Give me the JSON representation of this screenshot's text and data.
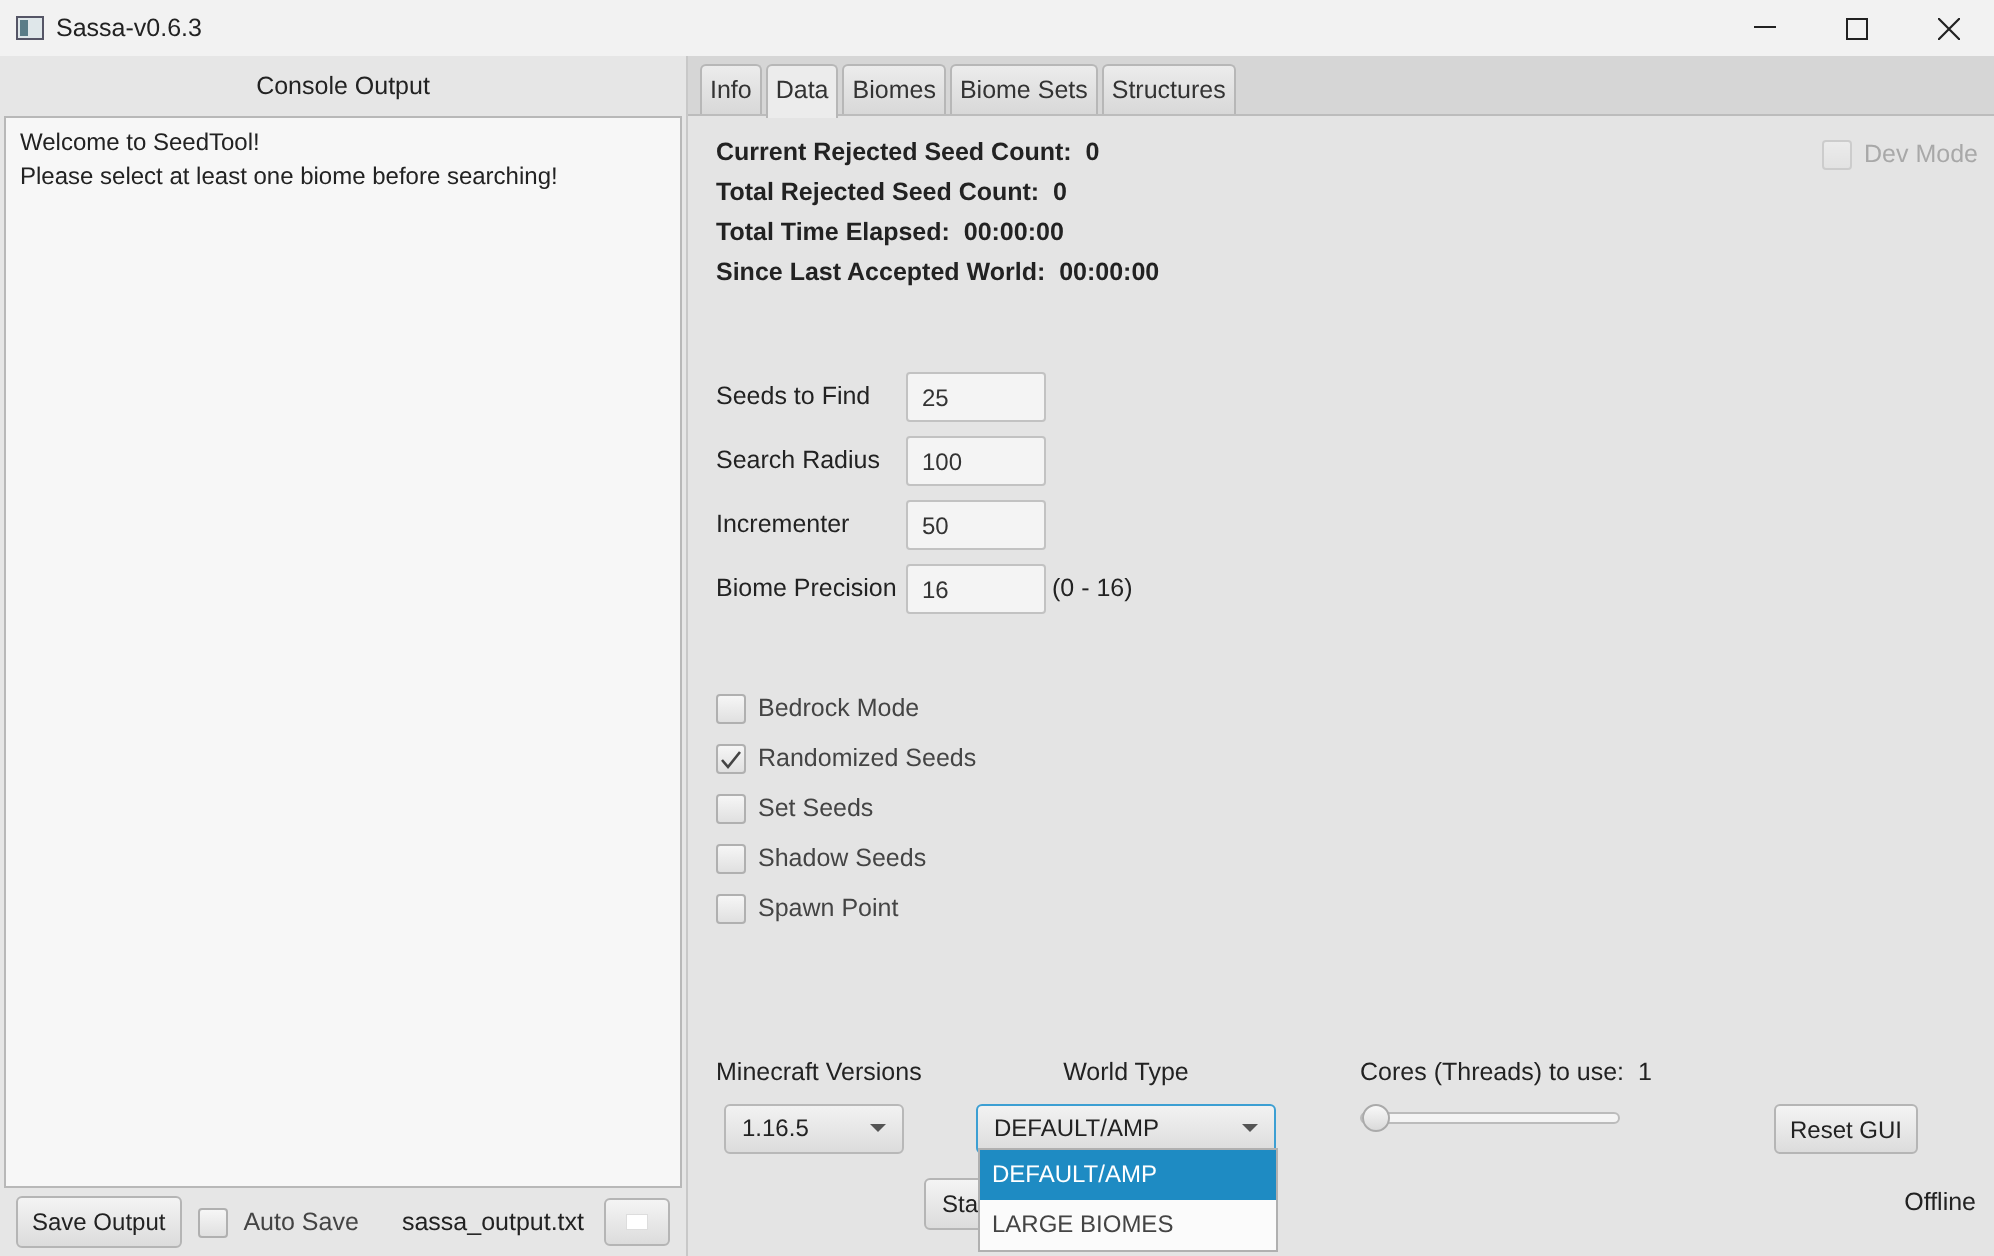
{
  "window": {
    "title": "Sassa-v0.6.3"
  },
  "console": {
    "title": "Console Output",
    "lines": [
      "Welcome to SeedTool!",
      "Please select at least one biome before searching!"
    ],
    "save_button": "Save Output",
    "auto_save": {
      "label": "Auto Save",
      "checked": false
    },
    "output_file": "sassa_output.txt"
  },
  "tabs": [
    {
      "label": "Info",
      "selected": false
    },
    {
      "label": "Data",
      "selected": true
    },
    {
      "label": "Biomes",
      "selected": false
    },
    {
      "label": "Biome Sets",
      "selected": false
    },
    {
      "label": "Structures",
      "selected": false
    }
  ],
  "dev_mode": {
    "label": "Dev Mode",
    "checked": false,
    "disabled": true
  },
  "stats": [
    {
      "label": "Current Rejected Seed Count:",
      "value": "0"
    },
    {
      "label": "Total Rejected Seed Count:",
      "value": "0"
    },
    {
      "label": "Total Time Elapsed:",
      "value": "00:00:00"
    },
    {
      "label": "Since Last Accepted World:",
      "value": "00:00:00"
    }
  ],
  "fields": [
    {
      "label": "Seeds to Find",
      "value": "25"
    },
    {
      "label": "Search Radius",
      "value": "100"
    },
    {
      "label": "Incrementer",
      "value": "50"
    },
    {
      "label": "Biome Precision",
      "value": "16",
      "hint": "(0 - 16)"
    }
  ],
  "options": [
    {
      "label": "Bedrock Mode",
      "checked": false
    },
    {
      "label": "Randomized Seeds",
      "checked": true
    },
    {
      "label": "Set Seeds",
      "checked": false
    },
    {
      "label": "Shadow Seeds",
      "checked": false
    },
    {
      "label": "Spawn Point",
      "checked": false
    }
  ],
  "versions": {
    "label": "Minecraft Versions",
    "value": "1.16.5"
  },
  "world_type": {
    "label": "World Type",
    "value": "DEFAULT/AMP",
    "expanded": true,
    "options": [
      {
        "label": "DEFAULT/AMP",
        "selected": true
      },
      {
        "label": "LARGE BIOMES",
        "selected": false
      }
    ]
  },
  "cores": {
    "label": "Cores (Threads) to use:",
    "value": "1",
    "level": 0
  },
  "reset_button": "Reset GUI",
  "start_button": "Sta",
  "status": "Offline"
}
